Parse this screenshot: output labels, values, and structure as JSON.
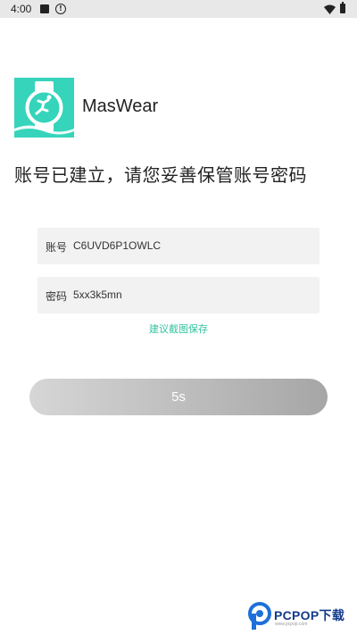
{
  "status_bar": {
    "time": "4:00",
    "icons": [
      "square-notification-icon",
      "alert-circle-icon",
      "wifi-icon",
      "battery-icon"
    ]
  },
  "app": {
    "name": "MasWear",
    "logo_icon": "watch-runner-logo-icon",
    "logo_color": "#35d4bb"
  },
  "headline": "账号已建立，请您妥善保管账号密码",
  "account": {
    "label": "账号",
    "value": "C6UVD6P1OWLC"
  },
  "password": {
    "label": "密码",
    "value": "5xx3k5mn"
  },
  "hint": "建议截图保存",
  "countdown_button": {
    "label": "5s"
  },
  "watermark": {
    "text": "PCPOP下载",
    "sub": "www.pcpop.com"
  },
  "colors": {
    "accent": "#34c2a0",
    "field_bg": "#f2f2f2",
    "button_gradient_start": "#d6d6d6",
    "button_gradient_end": "#a6a6a6"
  }
}
